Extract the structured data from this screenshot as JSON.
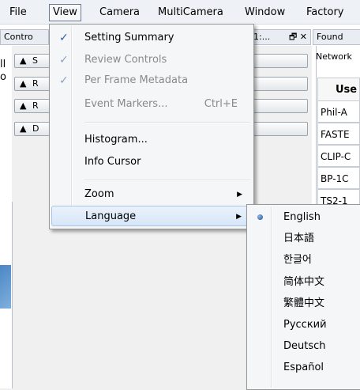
{
  "menubar": [
    "File",
    "View",
    "Camera",
    "MultiCamera",
    "Window",
    "Factory"
  ],
  "background": {
    "controls_header": "Contro",
    "middle_header": "1:...",
    "middle_header_icons": "🗗 ✕",
    "found_header": "Found",
    "network_label": "Network",
    "row_labels": [
      "S",
      "R",
      "R",
      "D"
    ],
    "cut_text": [
      "ll",
      "o"
    ],
    "table_header": "Use",
    "table_cells": [
      "Phil-A",
      "FASTE",
      "CLIP-C",
      "BP-1C",
      "TS2-1"
    ]
  },
  "view_menu": [
    {
      "label": "Setting Summary",
      "checked": true,
      "disabled": false
    },
    {
      "label": "Review Controls",
      "checked": true,
      "disabled": true
    },
    {
      "label": "Per Frame Metadata",
      "checked": true,
      "disabled": true
    },
    {
      "label": "Event Markers...",
      "shortcut": "Ctrl+E",
      "checked": false,
      "disabled": true
    },
    {
      "label": "Histogram...",
      "checked": false,
      "disabled": false
    },
    {
      "label": "Info Cursor",
      "checked": false,
      "disabled": false
    },
    {
      "label": "Zoom",
      "submenu": true
    },
    {
      "label": "Language",
      "submenu": true,
      "highlighted": true
    }
  ],
  "language_menu": [
    {
      "label": "English",
      "selected": true
    },
    {
      "label": "日本語"
    },
    {
      "label": "한글어"
    },
    {
      "label": "简体中文"
    },
    {
      "label": "繁體中文"
    },
    {
      "label": "Русский"
    },
    {
      "label": "Deutsch"
    },
    {
      "label": "Español"
    }
  ],
  "icons": {
    "check": "✓",
    "submenu_arrow": "▶",
    "expand_triangle": "▲"
  }
}
